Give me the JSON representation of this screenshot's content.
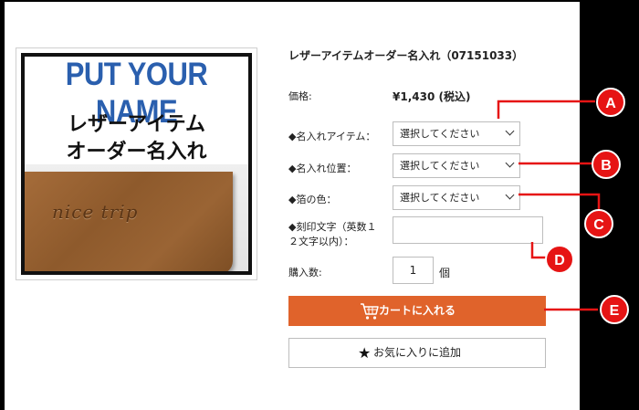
{
  "product": {
    "title": "レザーアイテムオーダー名入れ（07151033）",
    "image": {
      "headline": "PUT YOUR NAME",
      "line1": "レザーアイテム",
      "line2": "オーダー名入れ",
      "stamp": "nice trip"
    },
    "price_label": "価格:",
    "price_value": "¥1,430 (税込)"
  },
  "form": {
    "item": {
      "label": "◆名入れアイテム：",
      "value": "選択してください"
    },
    "position": {
      "label": "◆名入れ位置：",
      "value": "選択してください"
    },
    "foil": {
      "label": "◆箔の色：",
      "value": "選択してください"
    },
    "engrave": {
      "label_line1": "◆刻印文字（英数１",
      "label_line2": "２文字以内）：",
      "value": ""
    },
    "qty": {
      "label": "購入数:",
      "value": "1",
      "unit": "個"
    }
  },
  "buttons": {
    "cart": "カートに入れる",
    "favorite": "お気に入りに追加"
  },
  "callouts": [
    "A",
    "B",
    "C",
    "D",
    "E"
  ],
  "colors": {
    "accent": "#e0632b",
    "callout": "#e61414",
    "headline": "#2a5fae"
  }
}
